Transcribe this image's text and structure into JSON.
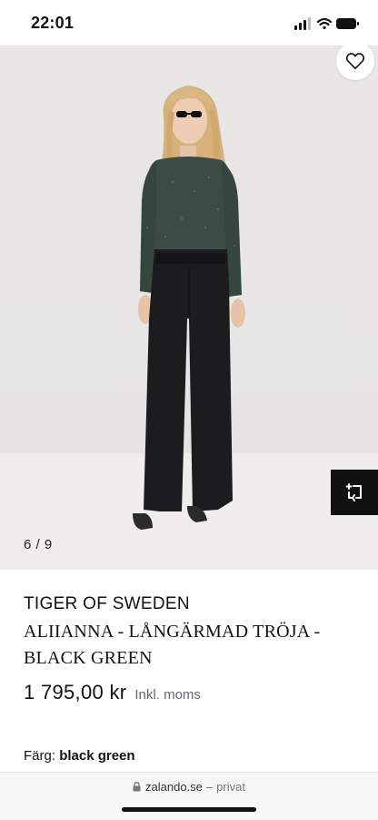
{
  "status_bar": {
    "time": "22:01"
  },
  "gallery": {
    "counter": "6 / 9"
  },
  "product": {
    "brand": "TIGER OF SWEDEN",
    "name": "ALIIANNA - LÅNGÄRMAD TRÖJA - BLACK GREEN",
    "price": "1 795,00 kr",
    "tax_note": "Inkl. moms",
    "color_label": "Färg:",
    "color_value": "black green"
  },
  "browser": {
    "domain": "zalando.se",
    "separator": "–",
    "mode": "privat"
  },
  "icons": {
    "wishlist": "heart-icon",
    "share": "share-frame-icon",
    "lock": "lock-icon",
    "signal": "cellular-signal-icon",
    "wifi": "wifi-icon",
    "battery": "battery-icon"
  },
  "colors": {
    "accent": "#111111",
    "background": "#ffffff",
    "image_bg": "#e7e6e4",
    "muted_text": "#66676e"
  }
}
